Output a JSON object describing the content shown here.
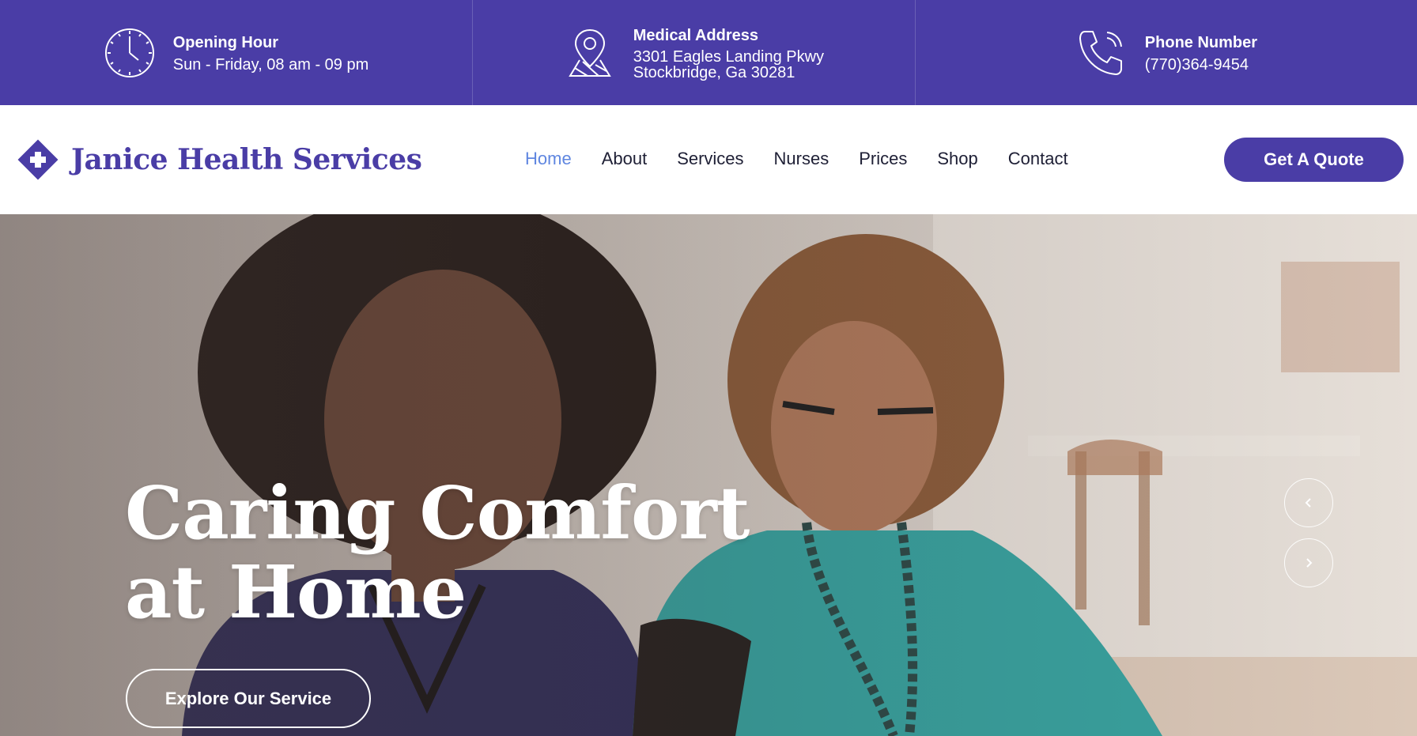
{
  "colors": {
    "brand": "#4a3da6",
    "nav_active": "#5f86e0",
    "nav_text": "#1e1f35",
    "white": "#ffffff"
  },
  "topbar": {
    "opening": {
      "icon": "clock-icon",
      "label": "Opening Hour",
      "value": "Sun - Friday, 08 am - 09 pm"
    },
    "address": {
      "icon": "map-pin-icon",
      "label": "Medical Address",
      "line1": "3301 Eagles Landing Pkwy",
      "line2": "Stockbridge, Ga 30281"
    },
    "phone": {
      "icon": "phone-icon",
      "label": "Phone Number",
      "value": "(770)364-9454"
    }
  },
  "header": {
    "brand_name": "Janice Health Services",
    "logo_icon": "medical-cross-diamond-icon",
    "nav": [
      {
        "label": "Home",
        "active": true
      },
      {
        "label": "About",
        "active": false
      },
      {
        "label": "Services",
        "active": false
      },
      {
        "label": "Nurses",
        "active": false
      },
      {
        "label": "Prices",
        "active": false
      },
      {
        "label": "Shop",
        "active": false
      },
      {
        "label": "Contact",
        "active": false
      }
    ],
    "cta_label": "Get A Quote"
  },
  "hero": {
    "title_line1": "Caring Comfort",
    "title_line2": "at Home",
    "button_label": "Explore Our Service",
    "prev_icon": "chevron-left-icon",
    "next_icon": "chevron-right-icon"
  }
}
